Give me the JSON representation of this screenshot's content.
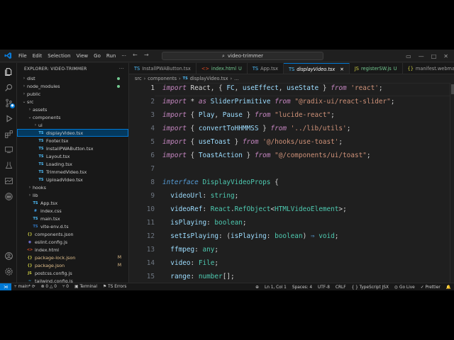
{
  "window": {
    "search_text": "video-trimmer",
    "menu": [
      "File",
      "Edit",
      "Selection",
      "View",
      "Go",
      "Run"
    ],
    "overflow": "···"
  },
  "colors": {
    "accent": "#0078d4",
    "modified": "#e2c08d",
    "untracked": "#73c991",
    "background": "#1f1f1f"
  },
  "explorer": {
    "title": "EXPLORER: VIDEO-TRIMMER",
    "items": [
      {
        "label": "dist",
        "kind": "folder",
        "open": false,
        "indent": 0,
        "status": ""
      },
      {
        "label": "node_modules",
        "kind": "folder",
        "open": false,
        "indent": 0,
        "status": ""
      },
      {
        "label": "public",
        "kind": "folder",
        "open": false,
        "indent": 0,
        "status": ""
      },
      {
        "label": "src",
        "kind": "folder",
        "open": true,
        "indent": 0,
        "status": ""
      },
      {
        "label": "assets",
        "kind": "folder",
        "open": false,
        "indent": 1,
        "status": ""
      },
      {
        "label": "components",
        "kind": "folder",
        "open": true,
        "indent": 1,
        "status": ""
      },
      {
        "label": "ui",
        "kind": "folder",
        "open": false,
        "indent": 2,
        "status": ""
      },
      {
        "label": "displayVideo.tsx",
        "kind": "tsx",
        "indent": 2,
        "status": "",
        "selected": true
      },
      {
        "label": "Footer.tsx",
        "kind": "tsx",
        "indent": 2,
        "status": ""
      },
      {
        "label": "InstallPWAButton.tsx",
        "kind": "tsx",
        "indent": 2,
        "status": ""
      },
      {
        "label": "Layout.tsx",
        "kind": "tsx",
        "indent": 2,
        "status": ""
      },
      {
        "label": "Loading.tsx",
        "kind": "tsx",
        "indent": 2,
        "status": ""
      },
      {
        "label": "TrimmedVideo.tsx",
        "kind": "tsx",
        "indent": 2,
        "status": ""
      },
      {
        "label": "UploadVideo.tsx",
        "kind": "tsx",
        "indent": 2,
        "status": ""
      },
      {
        "label": "hooks",
        "kind": "folder",
        "open": false,
        "indent": 1,
        "status": ""
      },
      {
        "label": "lib",
        "kind": "folder",
        "open": false,
        "indent": 1,
        "status": ""
      },
      {
        "label": "App.tsx",
        "kind": "tsx",
        "indent": 1,
        "status": ""
      },
      {
        "label": "index.css",
        "kind": "css",
        "indent": 1,
        "status": ""
      },
      {
        "label": "main.tsx",
        "kind": "tsx",
        "indent": 1,
        "status": ""
      },
      {
        "label": "vite-env.d.ts",
        "kind": "ts",
        "indent": 1,
        "status": ""
      },
      {
        "label": "components.json",
        "kind": "json",
        "indent": 0,
        "status": ""
      },
      {
        "label": "eslint.config.js",
        "kind": "eslint",
        "indent": 0,
        "status": ""
      },
      {
        "label": "index.html",
        "kind": "html",
        "indent": 0,
        "status": ""
      },
      {
        "label": "package-lock.json",
        "kind": "json",
        "indent": 0,
        "status": "M"
      },
      {
        "label": "package.json",
        "kind": "json",
        "indent": 0,
        "status": "M"
      },
      {
        "label": "postcss.config.js",
        "kind": "js",
        "indent": 0,
        "status": ""
      },
      {
        "label": "tailwind.config.js",
        "kind": "tw",
        "indent": 0,
        "status": ""
      }
    ]
  },
  "tabs": [
    {
      "label": "InstallPWAButton.tsx",
      "kind": "tsx",
      "status": "",
      "active": false
    },
    {
      "label": "index.html",
      "kind": "html",
      "status": "U",
      "active": false
    },
    {
      "label": "App.tsx",
      "kind": "tsx",
      "status": "",
      "active": false
    },
    {
      "label": "displayVideo.tsx",
      "kind": "tsx",
      "status": "",
      "active": true
    },
    {
      "label": "registerSW.js",
      "kind": "js",
      "status": "U",
      "active": false
    },
    {
      "label": "manifest.webma",
      "kind": "json",
      "status": "",
      "active": false
    }
  ],
  "breadcrumbs": [
    "src",
    "components",
    "displayVideo.tsx",
    "..."
  ],
  "editor": {
    "lines": [
      {
        "n": "1",
        "tokens": [
          [
            "kw",
            "import"
          ],
          [
            "pu",
            " React, { "
          ],
          [
            "va",
            "FC"
          ],
          [
            "pu",
            ", "
          ],
          [
            "va",
            "useEffect"
          ],
          [
            "pu",
            ", "
          ],
          [
            "va",
            "useState"
          ],
          [
            "pu",
            " } "
          ],
          [
            "kw",
            "from"
          ],
          [
            "pu",
            " "
          ],
          [
            "str",
            "'react'"
          ],
          [
            "pu",
            ";"
          ]
        ]
      },
      {
        "n": "2",
        "tokens": [
          [
            "kw",
            "import"
          ],
          [
            "pu",
            " * "
          ],
          [
            "kw",
            "as"
          ],
          [
            "pu",
            " "
          ],
          [
            "va",
            "SliderPrimitive"
          ],
          [
            "pu",
            " "
          ],
          [
            "kw",
            "from"
          ],
          [
            "pu",
            " "
          ],
          [
            "str",
            "\"@radix-ui/react-slider\""
          ],
          [
            "pu",
            ";"
          ]
        ]
      },
      {
        "n": "3",
        "tokens": [
          [
            "kw",
            "import"
          ],
          [
            "pu",
            " { "
          ],
          [
            "va",
            "Play"
          ],
          [
            "pu",
            ", "
          ],
          [
            "va",
            "Pause"
          ],
          [
            "pu",
            " } "
          ],
          [
            "kw",
            "from"
          ],
          [
            "pu",
            " "
          ],
          [
            "str",
            "\"lucide-react\""
          ],
          [
            "pu",
            ";"
          ]
        ]
      },
      {
        "n": "4",
        "tokens": [
          [
            "kw",
            "import"
          ],
          [
            "pu",
            " { "
          ],
          [
            "va",
            "convertToHHMMSS"
          ],
          [
            "pu",
            " } "
          ],
          [
            "kw",
            "from"
          ],
          [
            "pu",
            " "
          ],
          [
            "str",
            "'../lib/utils'"
          ],
          [
            "pu",
            ";"
          ]
        ]
      },
      {
        "n": "5",
        "tokens": [
          [
            "kw",
            "import"
          ],
          [
            "pu",
            " { "
          ],
          [
            "va",
            "useToast"
          ],
          [
            "pu",
            " } "
          ],
          [
            "kw",
            "from"
          ],
          [
            "pu",
            " "
          ],
          [
            "str",
            "'@/hooks/use-toast'"
          ],
          [
            "pu",
            ";"
          ]
        ]
      },
      {
        "n": "6",
        "tokens": [
          [
            "kw",
            "import"
          ],
          [
            "pu",
            " { "
          ],
          [
            "va",
            "ToastAction"
          ],
          [
            "pu",
            " } "
          ],
          [
            "kw",
            "from"
          ],
          [
            "pu",
            " "
          ],
          [
            "str",
            "\"@/components/ui/toast\""
          ],
          [
            "pu",
            ";"
          ]
        ]
      },
      {
        "n": "7",
        "tokens": []
      },
      {
        "n": "8",
        "tokens": [
          [
            "kw2",
            "interface"
          ],
          [
            "pu",
            " "
          ],
          [
            "ty",
            "DisplayVideoProps"
          ],
          [
            "pu",
            " {"
          ]
        ]
      },
      {
        "n": "9",
        "tokens": [
          [
            "pu",
            "  "
          ],
          [
            "va",
            "videoUrl"
          ],
          [
            "pu",
            ": "
          ],
          [
            "ty",
            "string"
          ],
          [
            "pu",
            ";"
          ]
        ]
      },
      {
        "n": "10",
        "tokens": [
          [
            "pu",
            "  "
          ],
          [
            "va",
            "videoRef"
          ],
          [
            "pu",
            ": "
          ],
          [
            "ty",
            "React"
          ],
          [
            "pu",
            "."
          ],
          [
            "ty",
            "RefObject"
          ],
          [
            "pu",
            "<"
          ],
          [
            "ty",
            "HTMLVideoElement"
          ],
          [
            "pu",
            ">;"
          ]
        ]
      },
      {
        "n": "11",
        "tokens": [
          [
            "pu",
            "  "
          ],
          [
            "va",
            "isPlaying"
          ],
          [
            "pu",
            ": "
          ],
          [
            "ty",
            "boolean"
          ],
          [
            "pu",
            ";"
          ]
        ]
      },
      {
        "n": "12",
        "tokens": [
          [
            "pu",
            "  "
          ],
          [
            "va",
            "setIsPlaying"
          ],
          [
            "pu",
            ": ("
          ],
          [
            "va",
            "isPlaying"
          ],
          [
            "pu",
            ": "
          ],
          [
            "ty",
            "boolean"
          ],
          [
            "pu",
            ") "
          ],
          [
            "kw2",
            "⇒"
          ],
          [
            "pu",
            " "
          ],
          [
            "ty",
            "void"
          ],
          [
            "pu",
            ";"
          ]
        ]
      },
      {
        "n": "13",
        "tokens": [
          [
            "pu",
            "  "
          ],
          [
            "va",
            "ffmpeg"
          ],
          [
            "pu",
            ": "
          ],
          [
            "ty",
            "any"
          ],
          [
            "pu",
            ";"
          ]
        ]
      },
      {
        "n": "14",
        "tokens": [
          [
            "pu",
            "  "
          ],
          [
            "va",
            "video"
          ],
          [
            "pu",
            ": "
          ],
          [
            "ty",
            "File"
          ],
          [
            "pu",
            ";"
          ]
        ]
      },
      {
        "n": "15",
        "tokens": [
          [
            "pu",
            "  "
          ],
          [
            "va",
            "range"
          ],
          [
            "pu",
            ": "
          ],
          [
            "ty",
            "number"
          ],
          [
            "pu",
            "[];"
          ]
        ]
      }
    ]
  },
  "status": {
    "branch": "main*",
    "problems": "⊗ 0 △ 0",
    "ports": "⑂ 0",
    "terminal": "Terminal",
    "ts_errors": "TS Errors",
    "position": "Ln 1, Col 1",
    "spaces": "Spaces: 4",
    "encoding": "UTF-8",
    "eol": "CRLF",
    "language": "{ } TypeScript JSX",
    "golive": "Go Live",
    "prettier": "✓ Prettier",
    "bell": "🔔"
  }
}
